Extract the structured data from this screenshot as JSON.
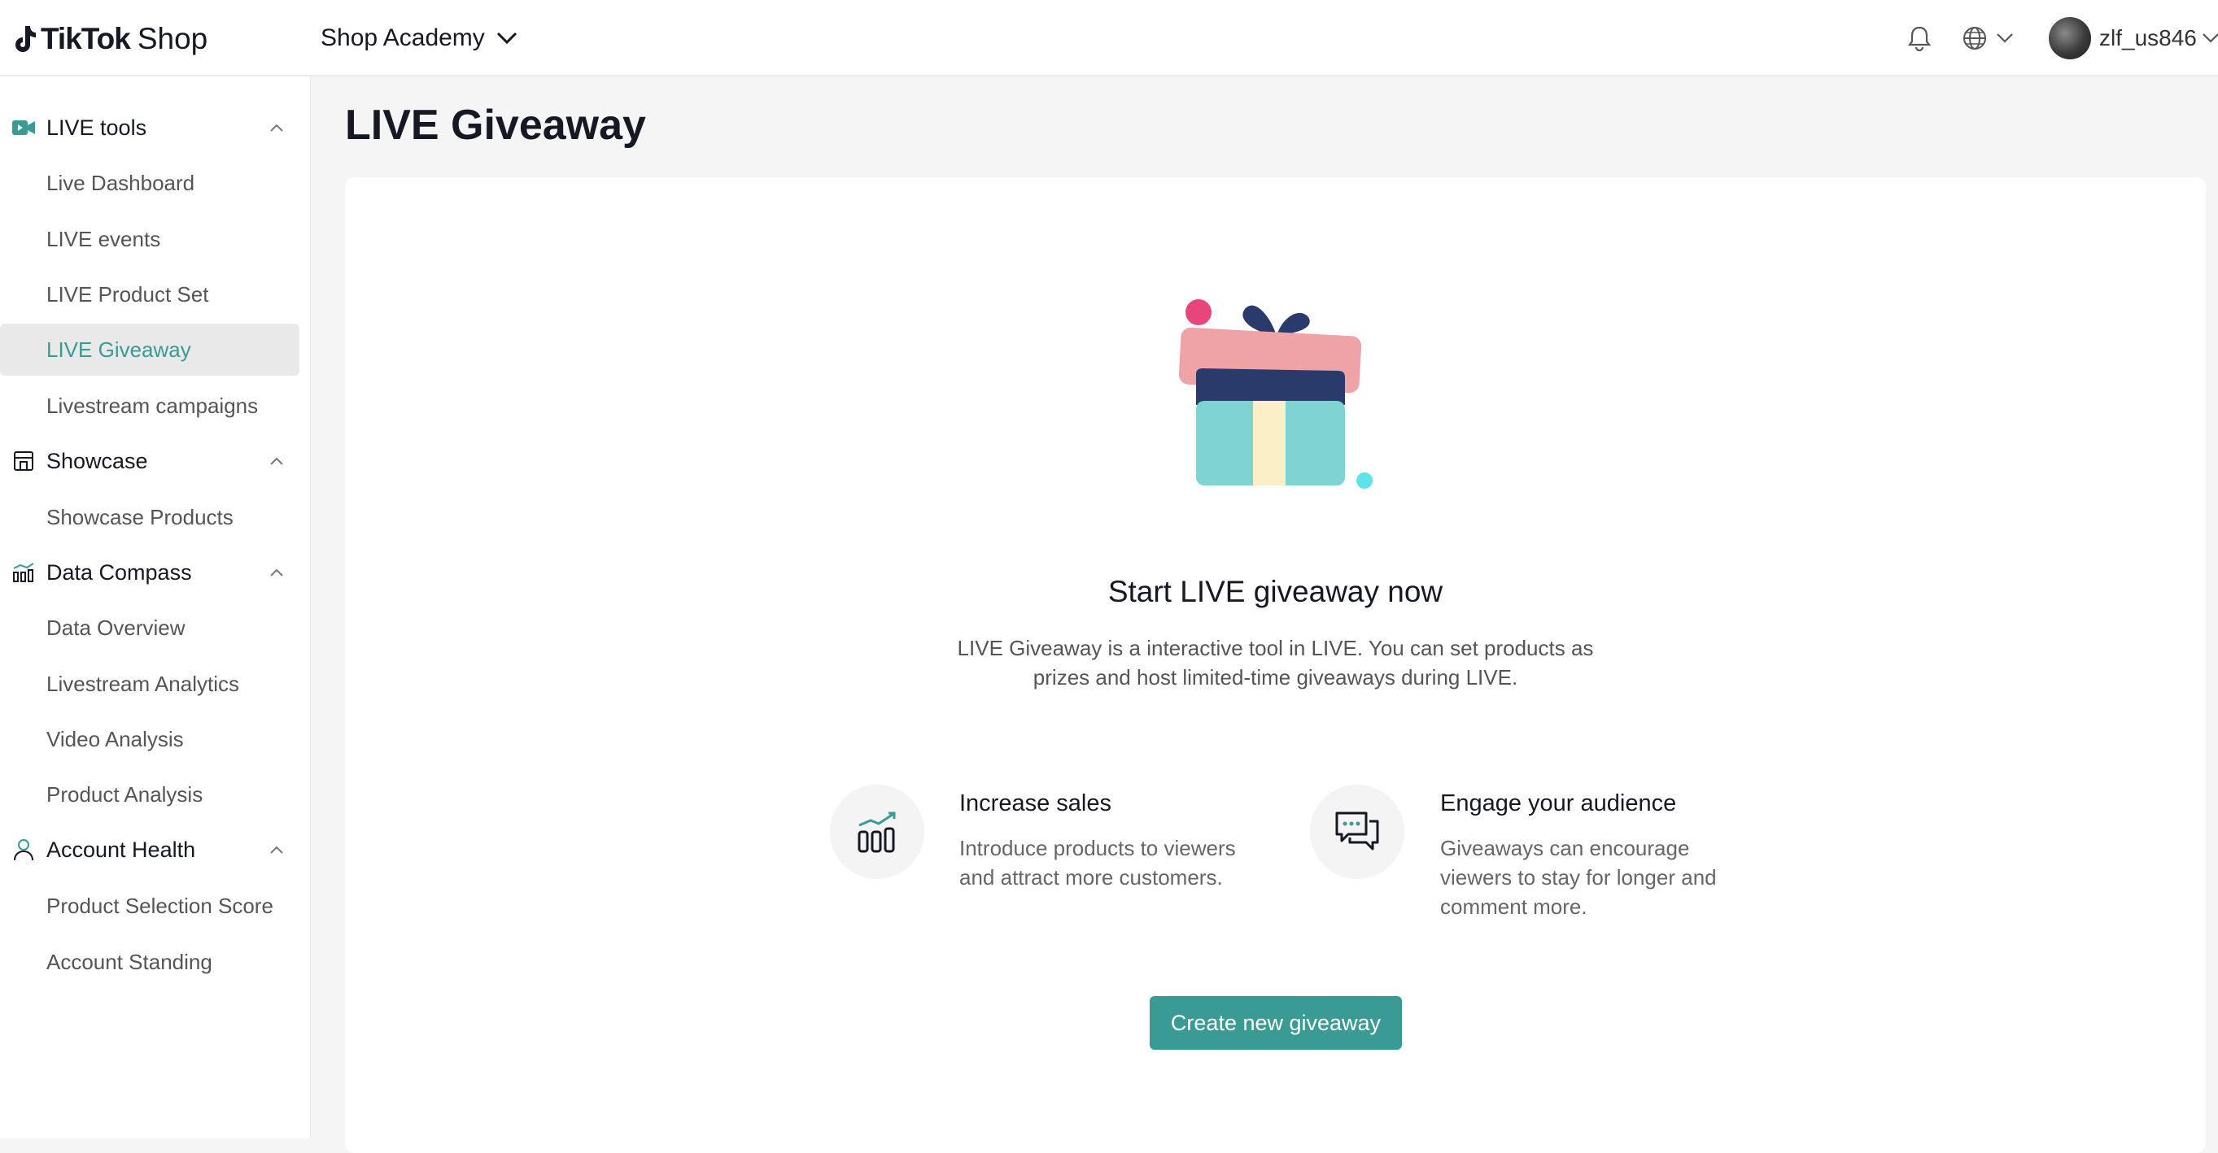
{
  "header": {
    "logo_brand": "TikTok",
    "logo_suffix": "Shop",
    "academy_menu": "Shop Academy",
    "username": "zlf_us846"
  },
  "sidebar": {
    "groups": [
      {
        "label": "LIVE tools",
        "icon": "video-icon",
        "items": [
          "Live Dashboard",
          "LIVE events",
          "LIVE Product Set",
          "LIVE Giveaway",
          "Livestream campaigns"
        ]
      },
      {
        "label": "Showcase",
        "icon": "store-icon",
        "items": [
          "Showcase Products"
        ]
      },
      {
        "label": "Data Compass",
        "icon": "bar-chart-icon",
        "items": [
          "Data Overview",
          "Livestream Analytics",
          "Video Analysis",
          "Product Analysis"
        ]
      },
      {
        "label": "Account Health",
        "icon": "person-icon",
        "items": [
          "Product Selection Score",
          "Account Standing"
        ]
      }
    ],
    "active_item": "LIVE Giveaway"
  },
  "main": {
    "page_title": "LIVE Giveaway",
    "hero_title": "Start LIVE giveaway now",
    "hero_desc": "LIVE Giveaway is a interactive tool in LIVE. You can set products as prizes and host limited-time giveaways during LIVE.",
    "features": [
      {
        "icon": "growth-chart-icon",
        "title": "Increase sales",
        "desc": "Introduce products to viewers and attract more customers."
      },
      {
        "icon": "chat-bubbles-icon",
        "title": "Engage your audience",
        "desc": "Giveaways can encourage viewers to stay for longer and comment more."
      }
    ],
    "cta_label": "Create new giveaway"
  },
  "colors": {
    "accent": "#3a9a94",
    "active_bg": "#e9e9e9",
    "gift_lid": "#f0a3a6",
    "gift_body": "#7fd4d2",
    "gift_ribbon": "#2a3a6b",
    "gift_stripe": "#fbefc8",
    "confetti_pink": "#e8457c",
    "confetti_cyan": "#5fe3e8"
  }
}
